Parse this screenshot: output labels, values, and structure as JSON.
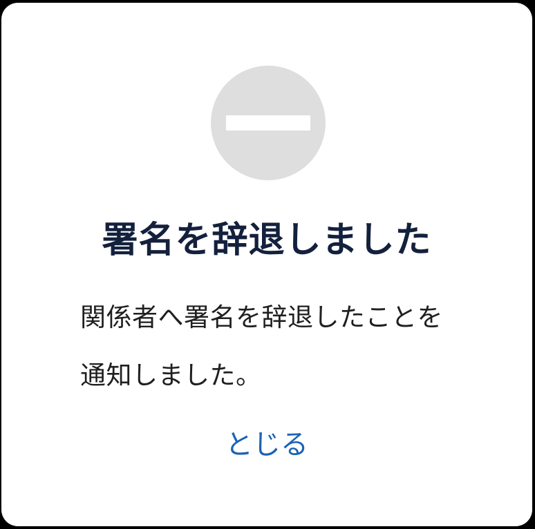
{
  "dialog": {
    "icon": "no-entry-icon",
    "title": "署名を辞退しました",
    "message": "関係者へ署名を辞退したことを通知しました。",
    "close_label": "とじる"
  },
  "colors": {
    "title": "#14213d",
    "message": "#1f1f1f",
    "close_link": "#1a64b4",
    "icon_circle": "#dedede",
    "background": "#ffffff"
  }
}
